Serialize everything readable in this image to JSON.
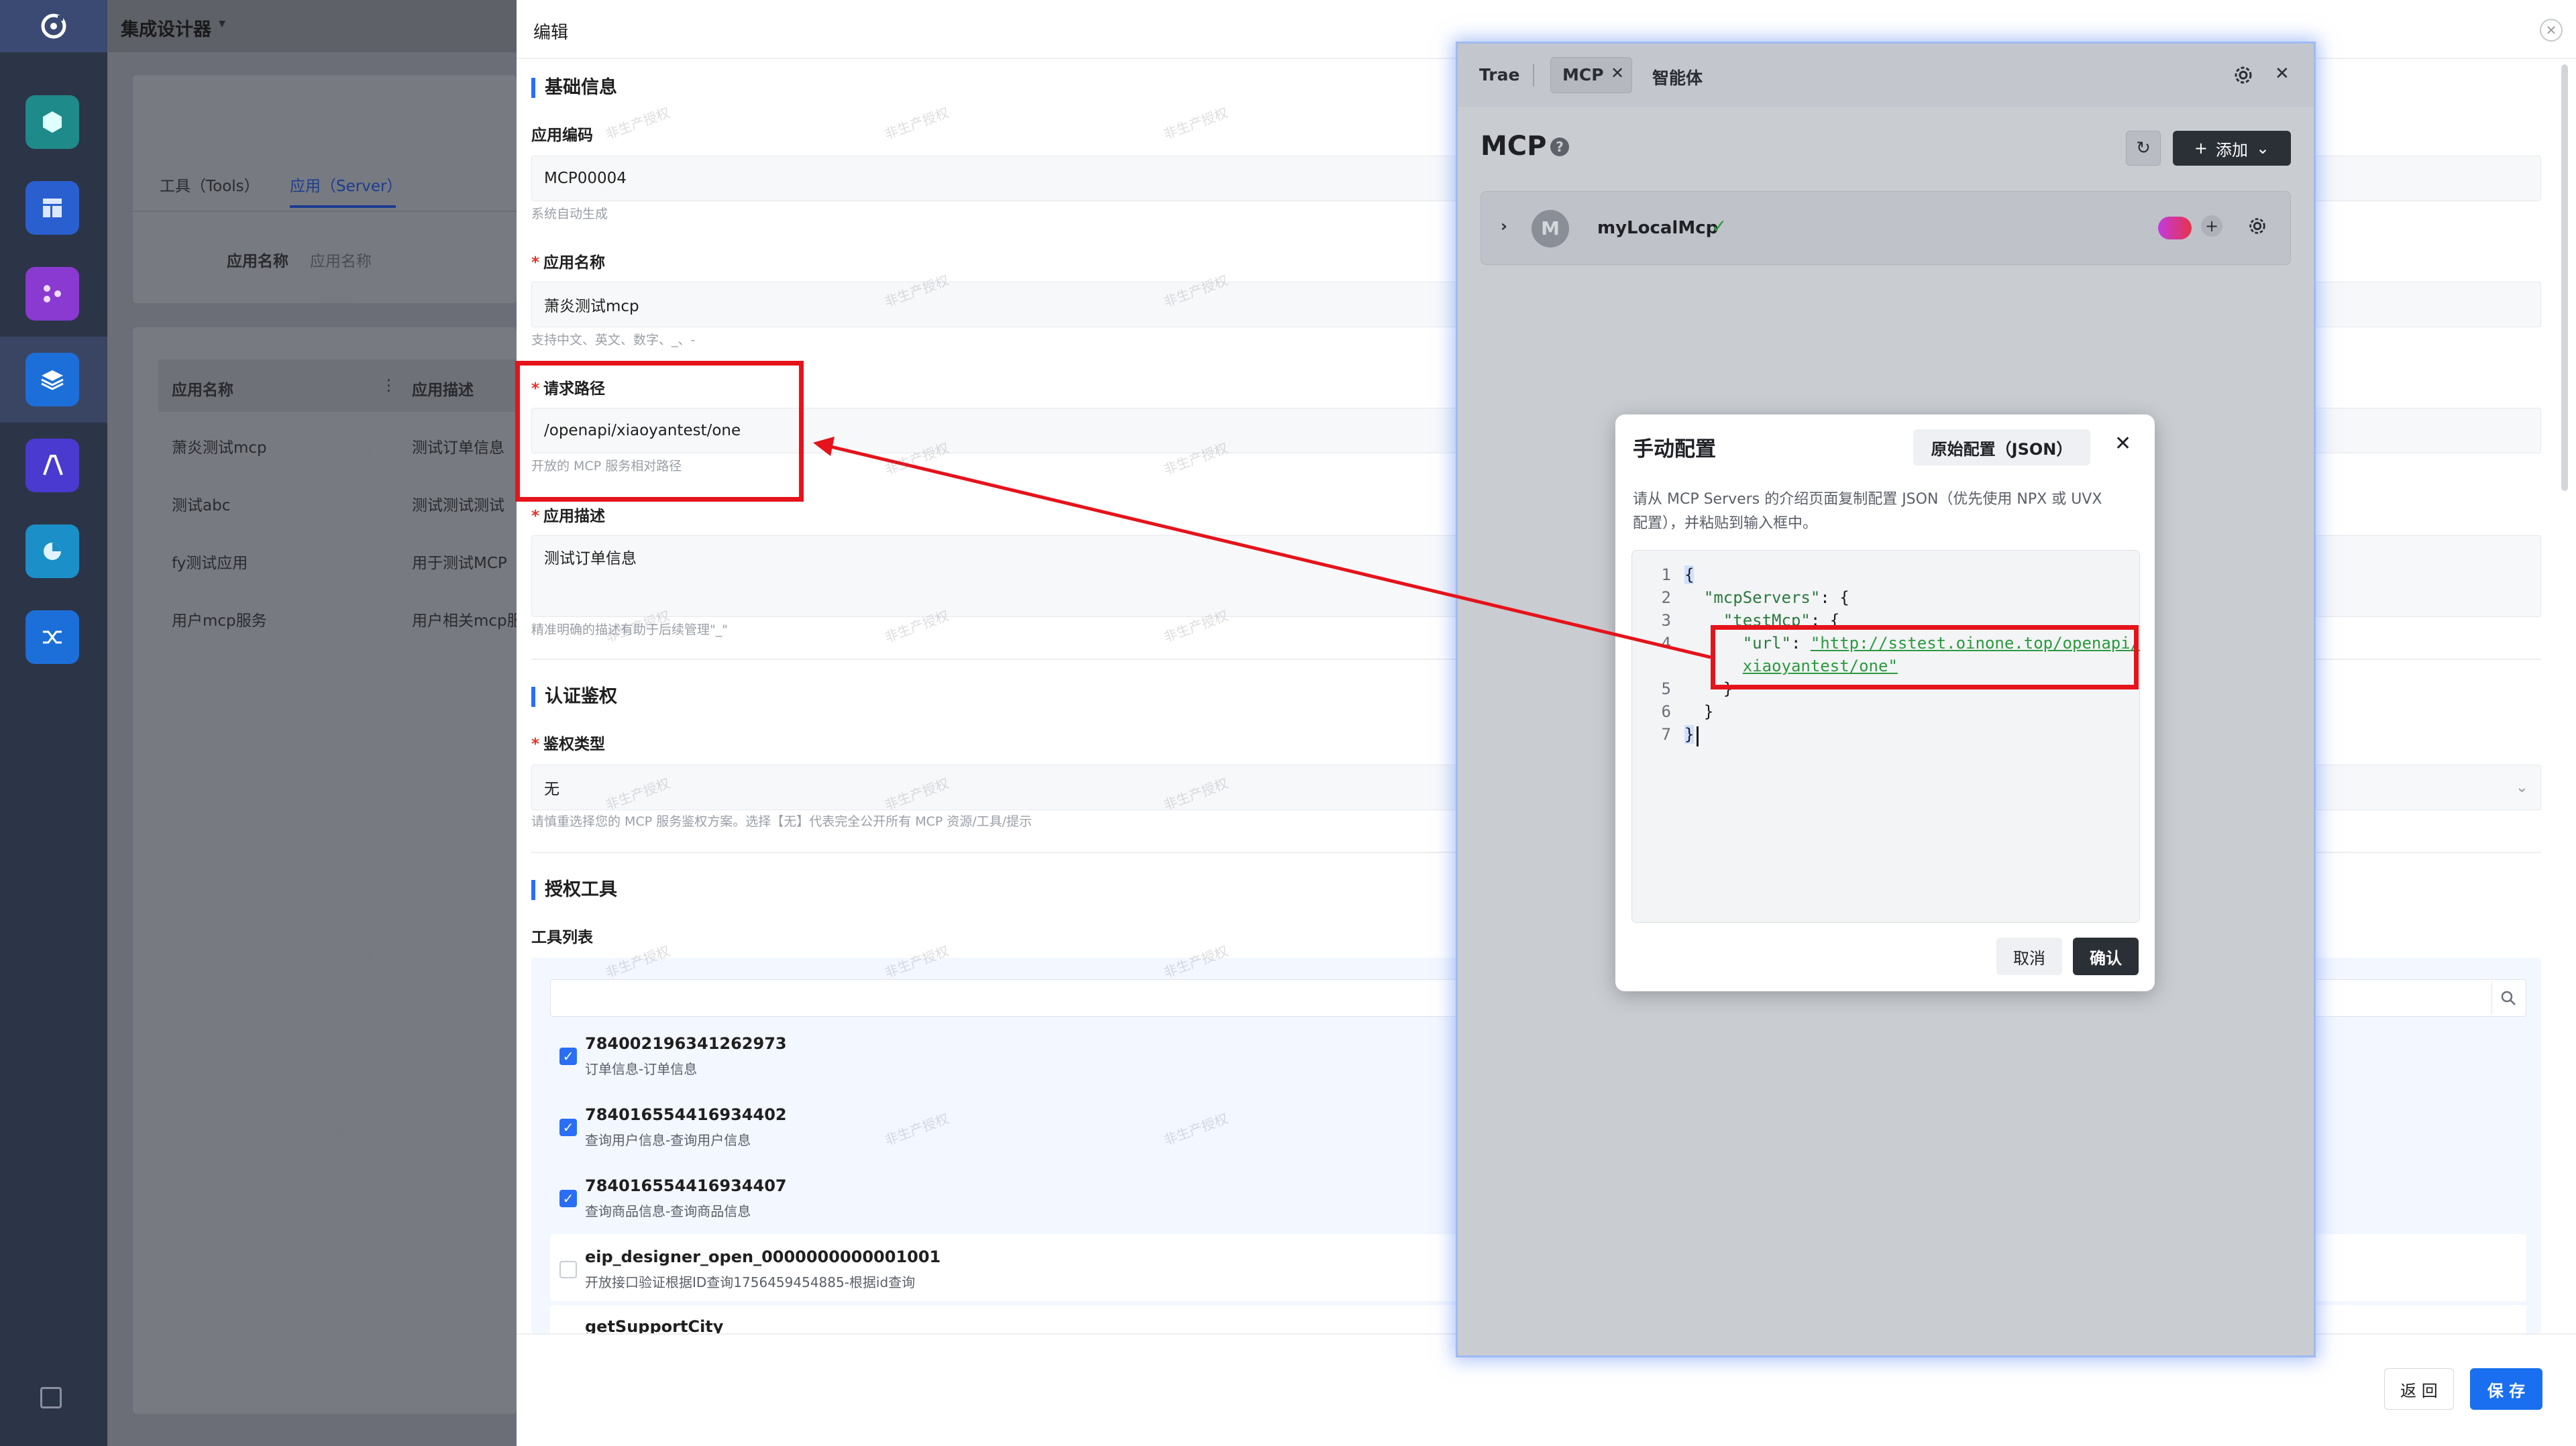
{
  "app": {
    "title": "集成设计器"
  },
  "bg": {
    "tabs": [
      "工具（Tools）",
      "应用（Server）"
    ],
    "filter_label": "应用名称",
    "filter_placeholder": "应用名称",
    "table": {
      "headers": [
        "应用名称",
        "应用描述"
      ],
      "rows": [
        [
          "萧炎测试mcp",
          "测试订单信息"
        ],
        [
          "测试abc",
          "测试测试测试"
        ],
        [
          "fy测试应用",
          "用于测试MCP"
        ],
        [
          "用户mcp服务",
          "用户相关mcp服"
        ]
      ]
    }
  },
  "drawer": {
    "title": "编辑",
    "basic": {
      "title": "基础信息",
      "code_label": "应用编码",
      "code_value": "MCP00004",
      "code_hint": "系统自动生成",
      "name_label": "应用名称",
      "name_value": "萧炎测试mcp",
      "name_hint": "支持中文、英文、数字、_、-",
      "path_label": "请求路径",
      "path_value": "/openapi/xiaoyantest/one",
      "path_hint": "开放的 MCP 服务相对路径",
      "desc_label": "应用描述",
      "desc_value": "测试订单信息",
      "desc_hint": "精准明确的描述有助于后续管理\"_\""
    },
    "auth": {
      "title": "认证鉴权",
      "type_label": "鉴权类型",
      "type_value": "无",
      "type_hint": "请慎重选择您的 MCP 服务鉴权方案。选择【无】代表完全公开所有 MCP 资源/工具/提示"
    },
    "tools": {
      "title": "授权工具",
      "list_label": "工具列表",
      "items": [
        {
          "name": "784002196341262973",
          "desc": "订单信息-订单信息",
          "checked": true
        },
        {
          "name": "784016554416934402",
          "desc": "查询用户信息-查询用户信息",
          "checked": true
        },
        {
          "name": "784016554416934407",
          "desc": "查询商品信息-查询商品信息",
          "checked": true
        },
        {
          "name": "eip_designer_open_0000000000001001",
          "desc": "开放接口验证根据ID查询1756459454885-根据id查询",
          "checked": false
        },
        {
          "name": "getSupportCity",
          "desc": "",
          "checked": false
        }
      ]
    },
    "footer": {
      "back": "返 回",
      "save": "保 存"
    }
  },
  "mcp_panel": {
    "tabs": [
      "Trae",
      "MCP",
      "智能体"
    ],
    "title": "MCP",
    "add_label": "添加",
    "server": {
      "avatar": "M",
      "name": "myLocalMcp"
    }
  },
  "modal": {
    "title": "手动配置",
    "raw_btn": "原始配置（JSON）",
    "desc_line1": "请从 MCP Servers 的介绍页面复制配置 JSON（优先使用 NPX 或 UVX",
    "desc_line2": "配置），并粘贴到输入框中。",
    "code": {
      "key_servers": "\"mcpServers\"",
      "key_test": "\"testMcp\"",
      "key_url": "\"url\"",
      "url_line1": "\"http://sstest.oinone.top/openapi/",
      "url_line2": "xiaoyantest/one\""
    },
    "cancel": "取消",
    "confirm": "确认"
  },
  "watermark": "非生产授权",
  "colors": {
    "accent": "#2a6ef5",
    "annotation": "#e5131b",
    "dark_btn": "#2b2f36"
  }
}
